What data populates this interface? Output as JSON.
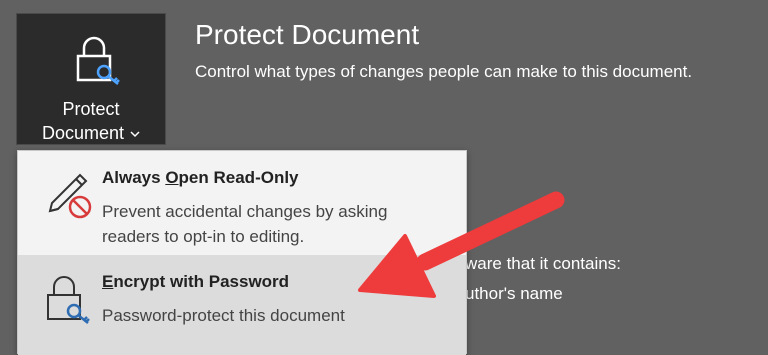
{
  "protect_tile": {
    "line1": "Protect",
    "line2": "Document",
    "chevron": "⌄",
    "icon": "lock-key-icon"
  },
  "header": {
    "title": "Protect Document",
    "subtitle": "Control what types of changes people can make to this document."
  },
  "background_text": {
    "line1": "ware that it contains:",
    "line2": "uthor's name"
  },
  "menu": {
    "items": [
      {
        "title_underline": "O",
        "title_pre": "Always ",
        "title_post": "pen Read-Only",
        "description": "Prevent accidental changes by asking readers to opt-in to editing.",
        "icon": "pencil-no-icon"
      },
      {
        "title_underline": "E",
        "title_pre": "",
        "title_post": "ncrypt with Password",
        "description": "Password-protect this document",
        "icon": "lock-key-icon"
      }
    ]
  },
  "colors": {
    "background": "#616161",
    "tile": "#2b2b2b",
    "menu": "#f3f3f3",
    "menu_hover": "#dcdcdc",
    "arrow": "#ee3b3b",
    "no_symbol": "#d83b3b",
    "key": "#2f6db3"
  }
}
